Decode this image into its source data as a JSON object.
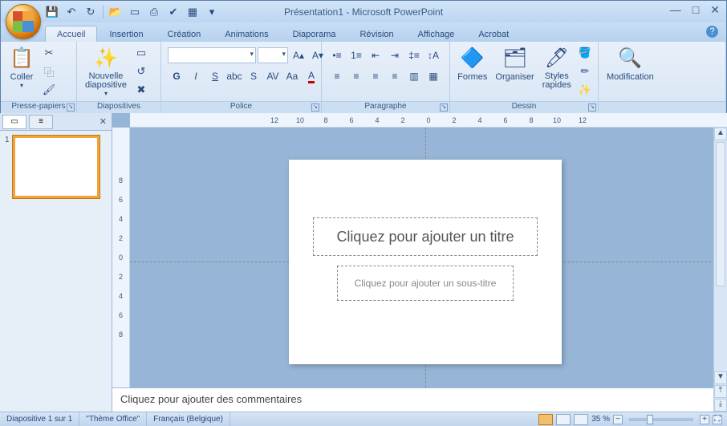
{
  "window": {
    "title": "Présentation1 - Microsoft PowerPoint"
  },
  "qat_tips": {
    "save": "Enregistrer",
    "undo": "Annuler",
    "redo": "Rétablir",
    "open": "Ouvrir",
    "new": "Nouveau",
    "print": "Impression rapide",
    "spell": "Orthographe",
    "inser": "Insérer"
  },
  "tabs": [
    "Accueil",
    "Insertion",
    "Création",
    "Animations",
    "Diaporama",
    "Révision",
    "Affichage",
    "Acrobat"
  ],
  "ribbon": {
    "clipboard": {
      "label": "Presse-papiers",
      "paste": "Coller"
    },
    "slides": {
      "label": "Diapositives",
      "new_slide": "Nouvelle\ndiapositive"
    },
    "font": {
      "label": "Police"
    },
    "paragraph": {
      "label": "Paragraphe"
    },
    "drawing": {
      "label": "Dessin",
      "shapes": "Formes",
      "arrange": "Organiser",
      "quick_styles": "Styles\nrapides"
    },
    "editing": {
      "label": "Modification",
      "find": "Modification"
    }
  },
  "slide": {
    "title_placeholder": "Cliquez pour ajouter un titre",
    "subtitle_placeholder": "Cliquez pour ajouter un sous-titre"
  },
  "notes_placeholder": "Cliquez pour ajouter des commentaires",
  "ruler_h": [
    "12",
    "10",
    "8",
    "6",
    "4",
    "2",
    "0",
    "2",
    "4",
    "6",
    "8",
    "10",
    "12"
  ],
  "ruler_v": [
    "8",
    "6",
    "4",
    "2",
    "0",
    "2",
    "4",
    "6",
    "8"
  ],
  "status": {
    "slide_of": "Diapositive 1 sur 1",
    "theme": "\"Thème Office\"",
    "lang": "Français (Belgique)",
    "zoom": "35 %"
  },
  "thumb": {
    "num": "1"
  }
}
